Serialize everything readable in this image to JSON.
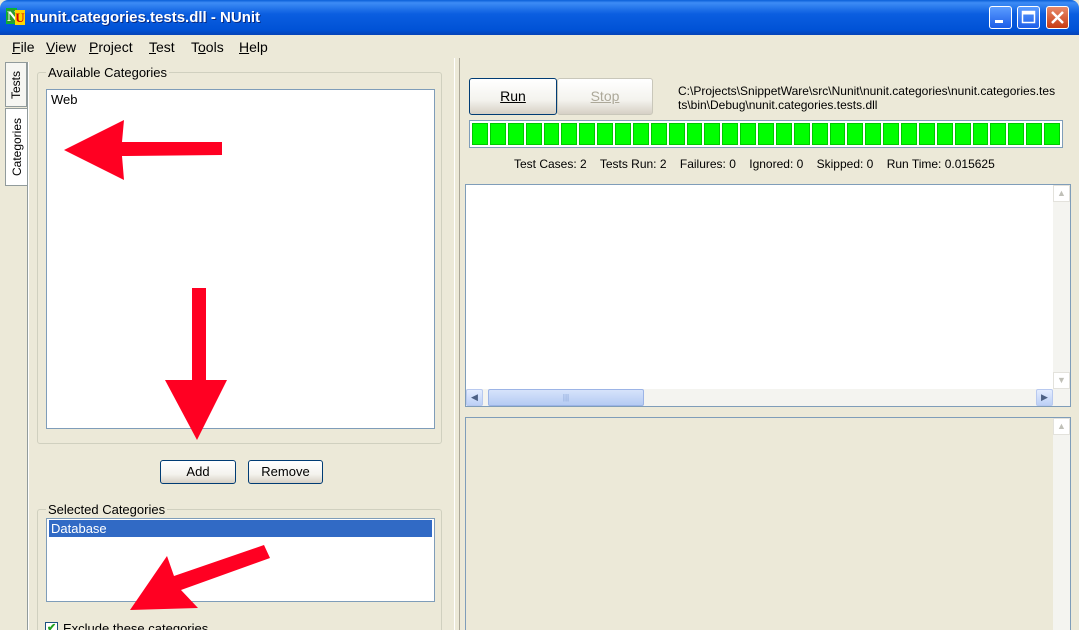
{
  "window": {
    "title": "nunit.categories.tests.dll - NUnit",
    "icon": "nunit-app-icon"
  },
  "menu": {
    "items": [
      {
        "label": "File",
        "mnemonic": "F"
      },
      {
        "label": "View",
        "mnemonic": "V"
      },
      {
        "label": "Project",
        "mnemonic": "P"
      },
      {
        "label": "Test",
        "mnemonic": "T"
      },
      {
        "label": "Tools",
        "mnemonic": "o"
      },
      {
        "label": "Help",
        "mnemonic": "H"
      }
    ]
  },
  "side_tabs": {
    "tests": "Tests",
    "categories": "Categories",
    "active": "categories"
  },
  "available": {
    "label": "Available Categories",
    "items": [
      "Web"
    ]
  },
  "buttons": {
    "add": "Add",
    "remove": "Remove",
    "run": "Run",
    "stop": "Stop"
  },
  "selected": {
    "label": "Selected Categories",
    "items": [
      "Database"
    ]
  },
  "exclude": {
    "label": "Exclude these categories",
    "checked": true
  },
  "assembly_path": "C:\\Projects\\SnippetWare\\src\\Nunit\\nunit.categories\\nunit.categories.tests\\bin\\Debug\\nunit.categories.tests.dll",
  "progress": {
    "value": 1.0,
    "color": "#00ff00",
    "segments": 33
  },
  "stats": {
    "test_cases": "Test Cases: 2",
    "tests_run": "Tests Run: 2",
    "failures": "Failures: 0",
    "ignored": "Ignored: 0",
    "skipped": "Skipped: 0",
    "run_time": "Run Time: 0.015625"
  },
  "colors": {
    "title_bar": "#0054e3",
    "selection": "#316ac5",
    "annotation_arrow": "#ff0022"
  }
}
